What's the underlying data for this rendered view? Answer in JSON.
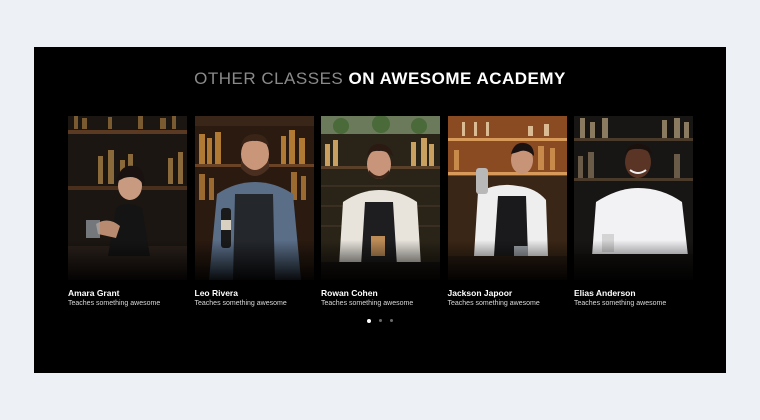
{
  "section": {
    "title_light": "OTHER CLASSES",
    "title_bold": "ON AWESOME ACADEMY"
  },
  "instructors": [
    {
      "name": "Amara Grant",
      "subtitle": "Teaches something awesome",
      "photo": "bartender-portrait-woman"
    },
    {
      "name": "Leo Rivera",
      "subtitle": "Teaches something awesome",
      "photo": "bartender-portrait-man-beard"
    },
    {
      "name": "Rowan Cohen",
      "subtitle": "Teaches something awesome",
      "photo": "bartender-portrait-man-pouring"
    },
    {
      "name": "Jackson Japoor",
      "subtitle": "Teaches something awesome",
      "photo": "bartender-portrait-man-shaker"
    },
    {
      "name": "Elias Anderson",
      "subtitle": "Teaches something awesome",
      "photo": "bartender-portrait-man-smiling"
    }
  ],
  "carousel": {
    "pages": 3,
    "active_page": 1
  },
  "colors": {
    "page_background": "#edf0f4",
    "panel_background": "#000000",
    "title_light": "#8a8a8a",
    "title_bold": "#ffffff"
  }
}
